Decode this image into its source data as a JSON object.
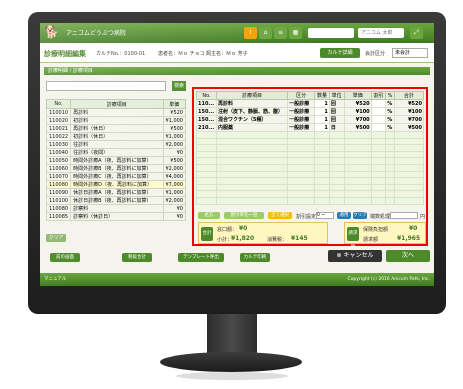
{
  "app": {
    "name": "アニコムどうぶつ病院",
    "page_title": "診療明細編集",
    "karte_label": "カルテNo.：0100-01",
    "patient_label": "患者名：Ｍｏ チョコ",
    "owner_label": "飼主名：Ｍｏ 芳子"
  },
  "header": {
    "karte_button": "カルテ詳細",
    "status_label": "会計区分",
    "status_value": "未会計",
    "search_placeholder": "アニコム 太郎"
  },
  "section_title": "診療明細 / 診療項目",
  "left_table": {
    "search_button": "検索",
    "headers": [
      "No.",
      "診療項目",
      "単価"
    ],
    "rows": [
      [
        "110010",
        "再診料",
        "¥520"
      ],
      [
        "110020",
        "初診料",
        "¥1,000"
      ],
      [
        "110021",
        "再診料（休日）",
        "¥500"
      ],
      [
        "110022",
        "初診料（休日）",
        "¥1,000"
      ],
      [
        "110030",
        "往診料",
        "¥2,000"
      ],
      [
        "110040",
        "往診料（夜間）",
        "¥0"
      ],
      [
        "110050",
        "時間外診療A（夜、再診料に加算）",
        "¥500"
      ],
      [
        "110060",
        "時間外診療B（夜、再診料に加算）",
        "¥2,000"
      ],
      [
        "110070",
        "時間外診療C（夜、再診料に加算）",
        "¥4,000"
      ],
      [
        "110080",
        "時間外診療D（夜、再診料に加算）",
        "¥7,000"
      ],
      [
        "110090",
        "休診日診療A（夜、再診料に加算）",
        "¥1,000"
      ],
      [
        "110100",
        "休診日診療B（夜、再診料に加算）",
        "¥2,000"
      ],
      [
        "110080",
        "診察料",
        "¥0"
      ],
      [
        "110085",
        "診察料（休診日）",
        "¥0"
      ]
    ],
    "highlight_index": 9,
    "clear_button": "クリア"
  },
  "right_table": {
    "headers": [
      "No.",
      "診療項目",
      "区分",
      "数量",
      "単位",
      "単価",
      "割引",
      "%",
      "合計"
    ],
    "rows": [
      [
        "110...",
        "再診料",
        "一般診療",
        "1",
        "回",
        "¥520",
        "",
        "%",
        "¥520"
      ],
      [
        "150...",
        "注射（皮下、静脈、筋、腹）",
        "一般診療",
        "1",
        "回",
        "¥100",
        "",
        "%",
        "¥100"
      ],
      [
        "150...",
        "混合ワクチン（5種）",
        "一般診療",
        "1",
        "回",
        "¥700",
        "",
        "%",
        "¥700"
      ],
      [
        "210...",
        "内服薬",
        "一般診療",
        "1",
        "日",
        "¥500",
        "",
        "%",
        "¥500"
      ]
    ],
    "empty_rows": 11,
    "option_buttons": [
      "処方",
      "割引率を一括",
      "全て選択"
    ],
    "discount_label": "割引設定",
    "discount_value": "0 ~",
    "apply_label": "適用",
    "clear_label": "クリア",
    "fraction_label": "端数処理",
    "yen_label": "円"
  },
  "summary": {
    "left_label": "合計",
    "subtotal_label": "窓口額：",
    "subtotal_value": "¥0",
    "tax_label": "小計：",
    "tax_value": "¥1,820",
    "consumption_label": "消費税：",
    "consumption_value": "¥145",
    "right_label": "請求額",
    "insurance_label": "保険負担額",
    "insurance_value": "¥0",
    "total_label": "請求額",
    "total_value": "¥1,965"
  },
  "bottom_buttons": [
    "前の画面",
    "税抜合計",
    "テンプレート呼出",
    "カルテ印刷"
  ],
  "cancel_button": "キャンセル",
  "next_button": "次へ",
  "footer": {
    "left": "マニュアル",
    "right": "Copyright (c) 2016 Anicom Pafe, Inc."
  }
}
